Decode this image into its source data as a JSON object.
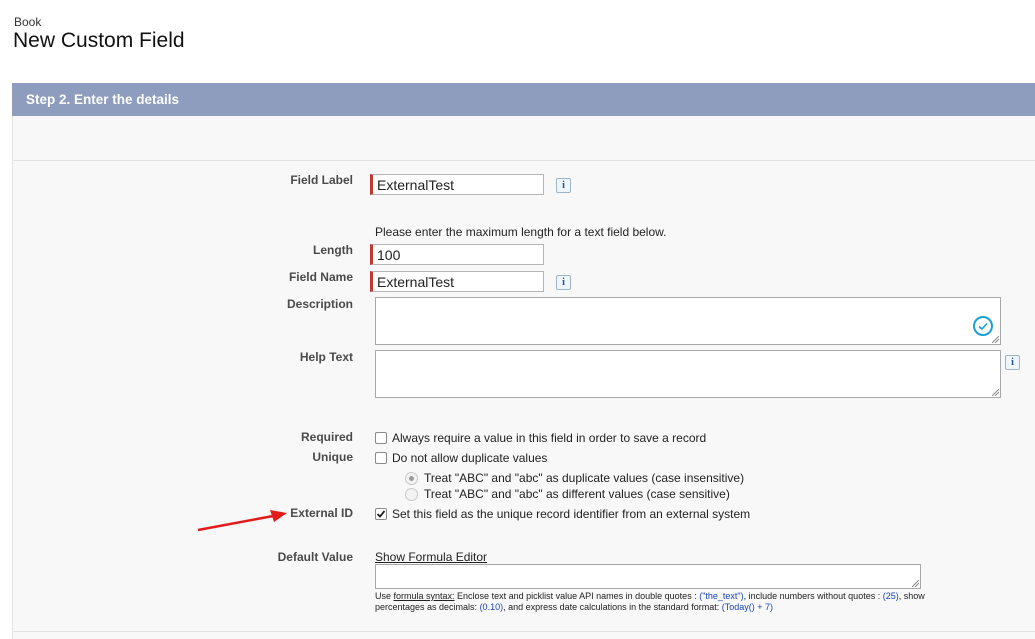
{
  "page": {
    "breadcrumb": "Book",
    "title": "New Custom Field",
    "step_title": "Step 2. Enter the details"
  },
  "form": {
    "field_label": {
      "label": "Field Label",
      "value": "ExternalTest"
    },
    "length_hint": "Please enter the maximum length for a text field below.",
    "length": {
      "label": "Length",
      "value": "100"
    },
    "field_name": {
      "label": "Field Name",
      "value": "ExternalTest"
    },
    "description": {
      "label": "Description",
      "value": ""
    },
    "help_text": {
      "label": "Help Text",
      "value": ""
    },
    "required": {
      "label": "Required",
      "text": "Always require a value in this field in order to save a record",
      "checked": false
    },
    "unique": {
      "label": "Unique",
      "text": "Do not allow duplicate values",
      "checked": false,
      "options": [
        {
          "text": "Treat \"ABC\" and \"abc\" as duplicate values (case insensitive)",
          "selected": true
        },
        {
          "text": "Treat \"ABC\" and \"abc\" as different values (case sensitive)",
          "selected": false
        }
      ]
    },
    "external_id": {
      "label": "External ID",
      "text": "Set this field as the unique record identifier from an external system",
      "checked": true
    },
    "default_value": {
      "label": "Default Value",
      "link": "Show Formula Editor",
      "help": {
        "use": "Use ",
        "syntax_link": "formula syntax:",
        "part1": " Enclose text and picklist value API names in double quotes : ",
        "code1": "(\"the_text\")",
        "part2": ", include numbers without quotes : ",
        "code2": "(25)",
        "part3": ", show percentages as decimals: ",
        "code3": "(0.10)",
        "part4": ", and express date calculations in the standard format: ",
        "code4": "(Today() + 7)"
      }
    }
  },
  "icons": {
    "info": "i",
    "check_status": "check-circle-icon",
    "annotation": "red-arrow"
  },
  "colors": {
    "header": "#8e9cbd",
    "required_bar": "#c23934",
    "arrow": "#e21b1b",
    "status_ring": "#1b9fd8",
    "code": "#1a45b8"
  }
}
